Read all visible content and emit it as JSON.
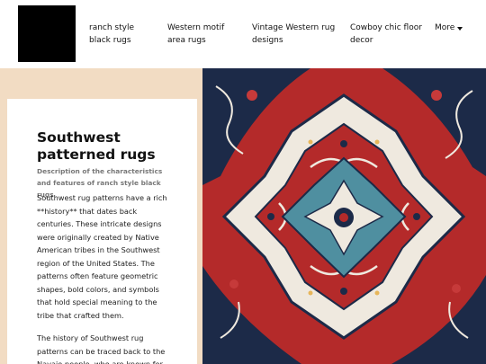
{
  "nav": {
    "items": [
      {
        "label": "ranch style black rugs"
      },
      {
        "label": "Western motif area rugs"
      },
      {
        "label": "Vintage Western rug designs"
      },
      {
        "label": "Cowboy chic floor decor"
      }
    ],
    "more_label": "More"
  },
  "article": {
    "title": "Southwest patterned rugs",
    "subtitle": "Description of the characteristics and features of ranch style black rugs",
    "paragraphs": [
      "Southwest rug patterns have a rich **history** that dates back centuries. These intricate designs were originally created by Native American tribes in the Southwest region of the United States. The patterns often feature geometric shapes, bold colors, and symbols that hold special meaning to the tribe that crafted them.",
      "The history of Southwest rug patterns can be traced back to the Navajo people, who are known for"
    ]
  },
  "colors": {
    "accent_panel": "#f2dcc3",
    "rug_red": "#b42a2a",
    "rug_navy": "#1c2a48",
    "rug_ivory": "#efe9df",
    "rug_teal": "#4f8fa0"
  },
  "icons": {
    "more_caret": "chevron-down-icon"
  }
}
